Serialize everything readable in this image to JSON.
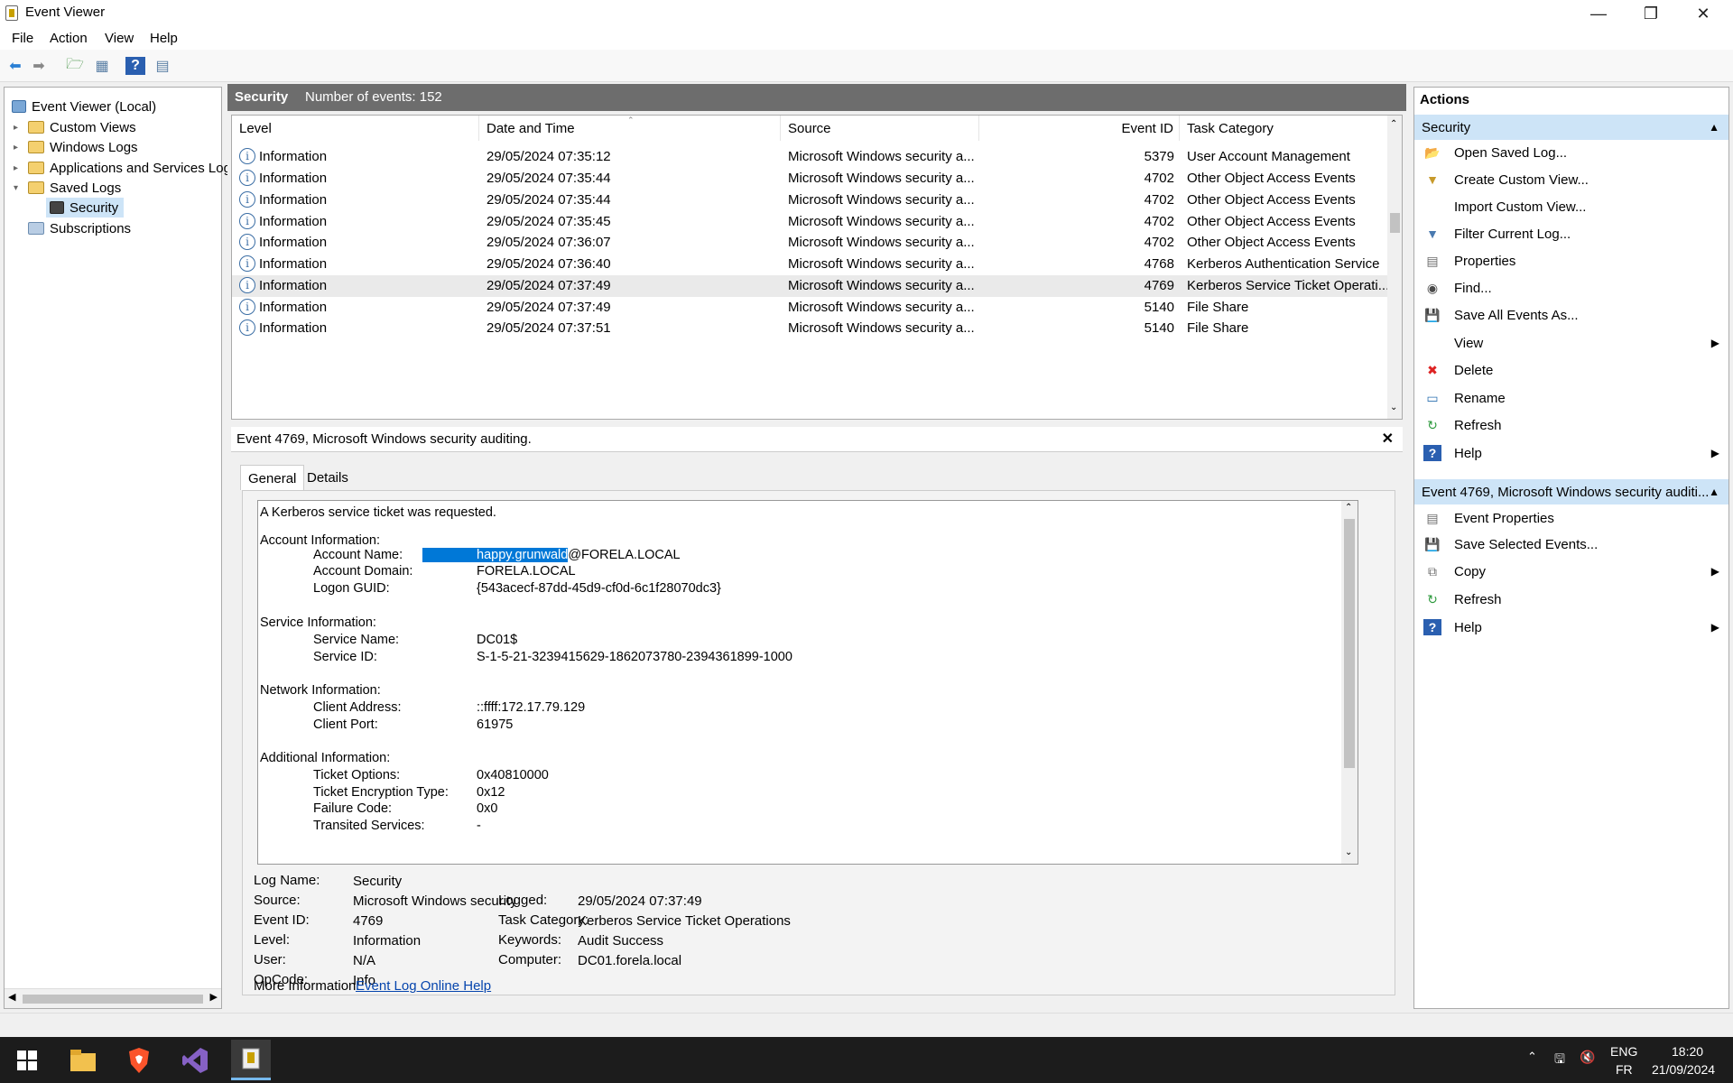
{
  "window": {
    "title": "Event Viewer"
  },
  "menu": [
    "File",
    "Action",
    "View",
    "Help"
  ],
  "tree": {
    "root": "Event Viewer (Local)",
    "items": [
      "Custom Views",
      "Windows Logs",
      "Applications and Services Log",
      "Saved Logs",
      "Security",
      "Subscriptions"
    ]
  },
  "list": {
    "header_name": "Security",
    "header_count": "Number of events: 152",
    "columns": [
      "Level",
      "Date and Time",
      "Source",
      "Event ID",
      "Task Category"
    ],
    "rows": [
      {
        "level": "Information",
        "date": "29/05/2024 07:35:12",
        "source": "Microsoft Windows security a...",
        "id": "5379",
        "task": "User Account Management"
      },
      {
        "level": "Information",
        "date": "29/05/2024 07:35:44",
        "source": "Microsoft Windows security a...",
        "id": "4702",
        "task": "Other Object Access Events"
      },
      {
        "level": "Information",
        "date": "29/05/2024 07:35:44",
        "source": "Microsoft Windows security a...",
        "id": "4702",
        "task": "Other Object Access Events"
      },
      {
        "level": "Information",
        "date": "29/05/2024 07:35:45",
        "source": "Microsoft Windows security a...",
        "id": "4702",
        "task": "Other Object Access Events"
      },
      {
        "level": "Information",
        "date": "29/05/2024 07:36:07",
        "source": "Microsoft Windows security a...",
        "id": "4702",
        "task": "Other Object Access Events"
      },
      {
        "level": "Information",
        "date": "29/05/2024 07:36:40",
        "source": "Microsoft Windows security a...",
        "id": "4768",
        "task": "Kerberos Authentication Service"
      },
      {
        "level": "Information",
        "date": "29/05/2024 07:37:49",
        "source": "Microsoft Windows security a...",
        "id": "4769",
        "task": "Kerberos Service Ticket Operati..."
      },
      {
        "level": "Information",
        "date": "29/05/2024 07:37:49",
        "source": "Microsoft Windows security a...",
        "id": "5140",
        "task": "File Share"
      },
      {
        "level": "Information",
        "date": "29/05/2024 07:37:51",
        "source": "Microsoft Windows security a...",
        "id": "5140",
        "task": "File Share"
      }
    ]
  },
  "detail": {
    "title": "Event 4769, Microsoft Windows security auditing.",
    "tabs": [
      "General",
      "Details"
    ],
    "desc": {
      "intro": "A Kerberos service ticket was requested.",
      "account_header": "Account Information:",
      "account_name_label": "Account Name:",
      "account_name_sel": "happy.grunwald",
      "account_name_rest": "@FORELA.LOCAL",
      "account_domain_label": "Account Domain:",
      "account_domain": "FORELA.LOCAL",
      "logon_guid_label": "Logon GUID:",
      "logon_guid": "{543acecf-87dd-45d9-cf0d-6c1f28070dc3}",
      "service_header": "Service Information:",
      "service_name_label": "Service Name:",
      "service_name": "DC01$",
      "service_id_label": "Service ID:",
      "service_id": "S-1-5-21-3239415629-1862073780-2394361899-1000",
      "network_header": "Network Information:",
      "client_address_label": "Client Address:",
      "client_address": "::ffff:172.17.79.129",
      "client_port_label": "Client Port:",
      "client_port": "61975",
      "additional_header": "Additional Information:",
      "ticket_options_label": "Ticket Options:",
      "ticket_options": "0x40810000",
      "ticket_enc_label": "Ticket Encryption Type:",
      "ticket_enc": "0x12",
      "failure_code_label": "Failure Code:",
      "failure_code": "0x0",
      "transited_label": "Transited Services:",
      "transited": "-"
    },
    "fields": {
      "log_name_label": "Log Name:",
      "log_name": "Security",
      "source_label": "Source:",
      "source": "Microsoft Windows security a",
      "logged_label": "Logged:",
      "logged": "29/05/2024 07:37:49",
      "event_id_label": "Event ID:",
      "event_id": "4769",
      "task_label": "Task Category:",
      "task": "Kerberos Service Ticket Operations",
      "level_label": "Level:",
      "level": "Information",
      "keywords_label": "Keywords:",
      "keywords": "Audit Success",
      "user_label": "User:",
      "user": "N/A",
      "computer_label": "Computer:",
      "computer": "DC01.forela.local",
      "opcode_label": "OpCode:",
      "opcode": "Info",
      "more_label": "More Information:",
      "more_link": "Event Log Online Help"
    }
  },
  "actions": {
    "title": "Actions",
    "section1": "Security",
    "items1": [
      "Open Saved Log...",
      "Create Custom View...",
      "Import Custom View...",
      "Filter Current Log...",
      "Properties",
      "Find...",
      "Save All Events As...",
      "View",
      "Delete",
      "Rename",
      "Refresh",
      "Help"
    ],
    "section2": "Event 4769, Microsoft Windows security auditi...",
    "items2": [
      "Event Properties",
      "Save Selected Events...",
      "Copy",
      "Refresh",
      "Help"
    ]
  },
  "taskbar": {
    "lang1": "ENG",
    "lang2": "FR",
    "time": "18:20",
    "date": "21/09/2024"
  }
}
